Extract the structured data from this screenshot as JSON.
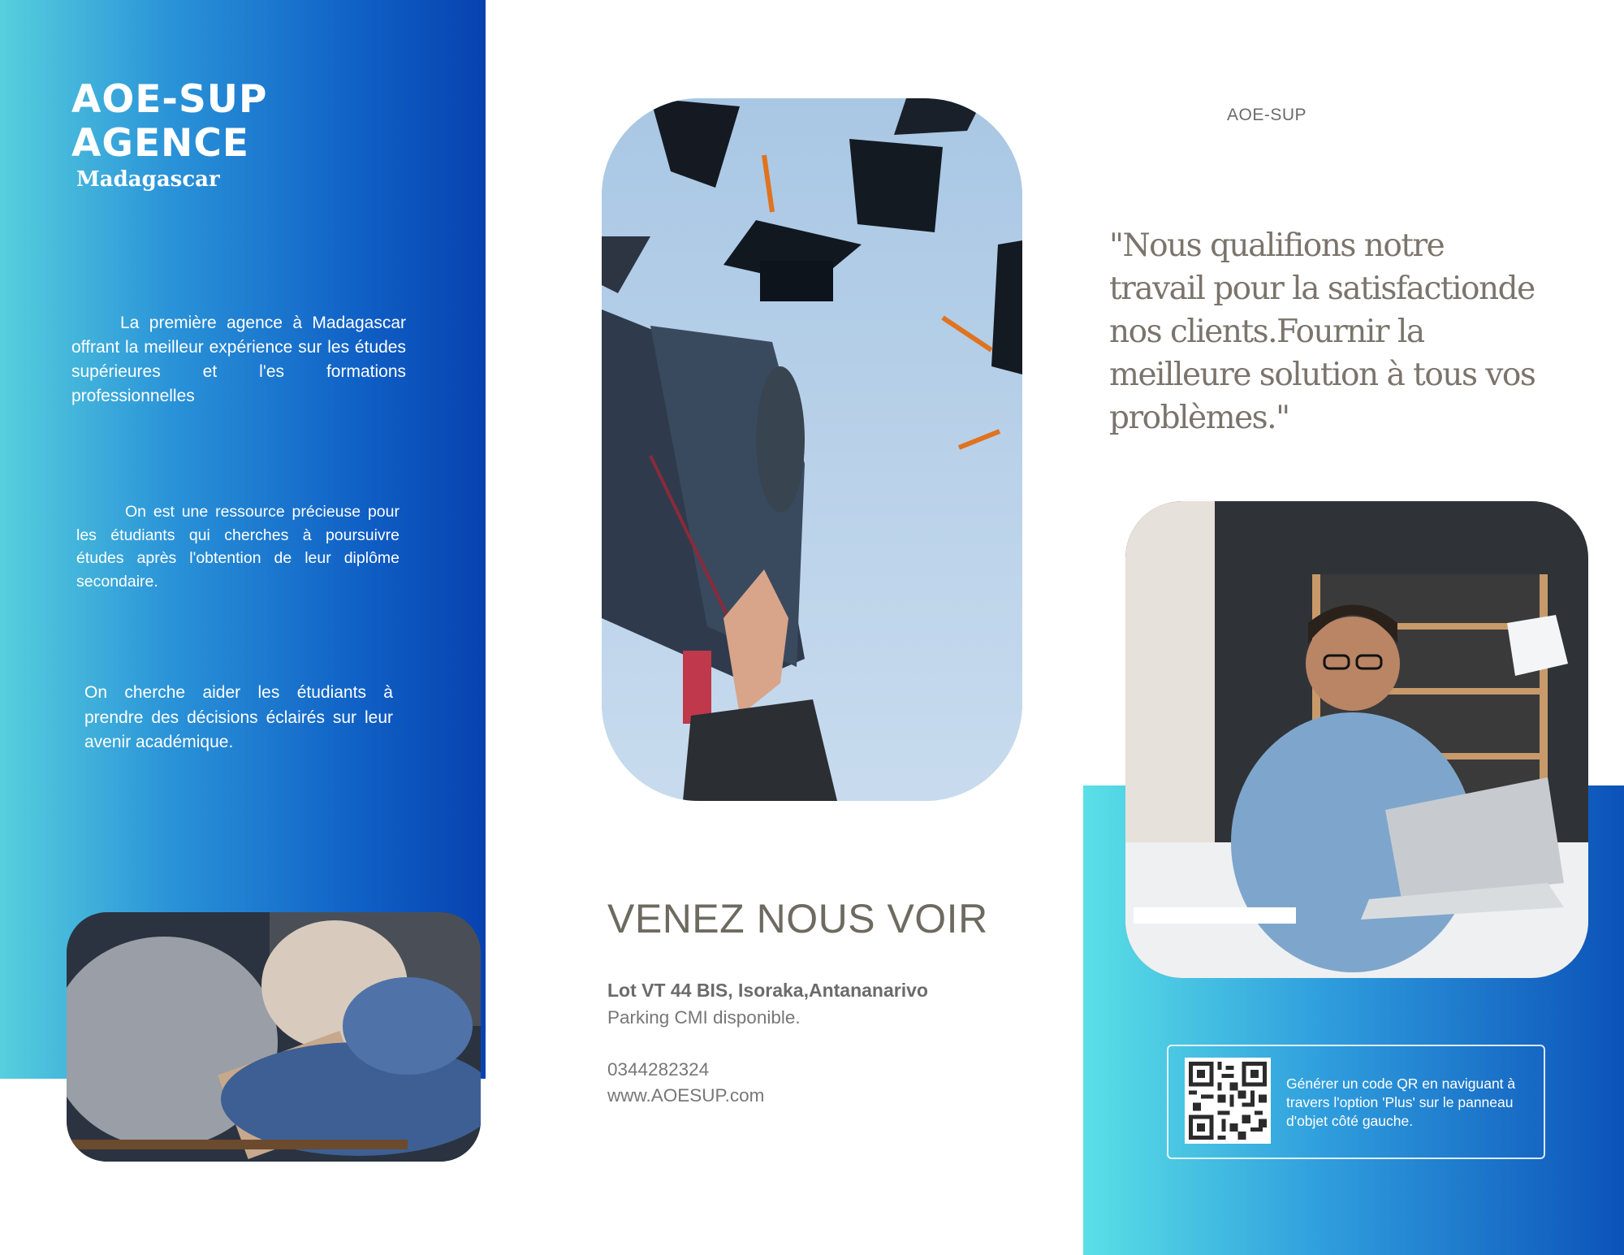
{
  "left_panel": {
    "title_line1": "AOE-SUP",
    "title_line2": "AGENCE",
    "subtitle": "Madagascar",
    "paragraph1": "La première agence à Madagascar offrant la meilleur expérience sur les études supérieures et l'es formations professionnelles",
    "paragraph2": "On est une ressource précieuse pour les étudiants qui cherches à poursuivre études après l'obtention de leur diplôme secondaire.",
    "paragraph3": "On cherche aider les étudiants à prendre des décisions éclairés sur leur avenir académique."
  },
  "middle": {
    "heading": "VENEZ NOUS VOIR",
    "address": "Lot VT 44 BIS, Isoraka,Antananarivo",
    "parking": "Parking CMI disponible.",
    "phone": "0344282324",
    "website": "www.AOESUP.com"
  },
  "right": {
    "label": "AOE-SUP",
    "quote": "\"Nous qualifions notre travail pour la satisfactionde nos clients.Fournir la meilleure solution à tous vos problèmes.\"",
    "qr_text": "Générer un code QR en naviguant à travers l'option 'Plus' sur le panneau d'objet côté gauche."
  },
  "colors": {
    "gradient_light": "#57cfdd",
    "gradient_dark": "#0842b0",
    "text_gray": "#6e6a60"
  }
}
